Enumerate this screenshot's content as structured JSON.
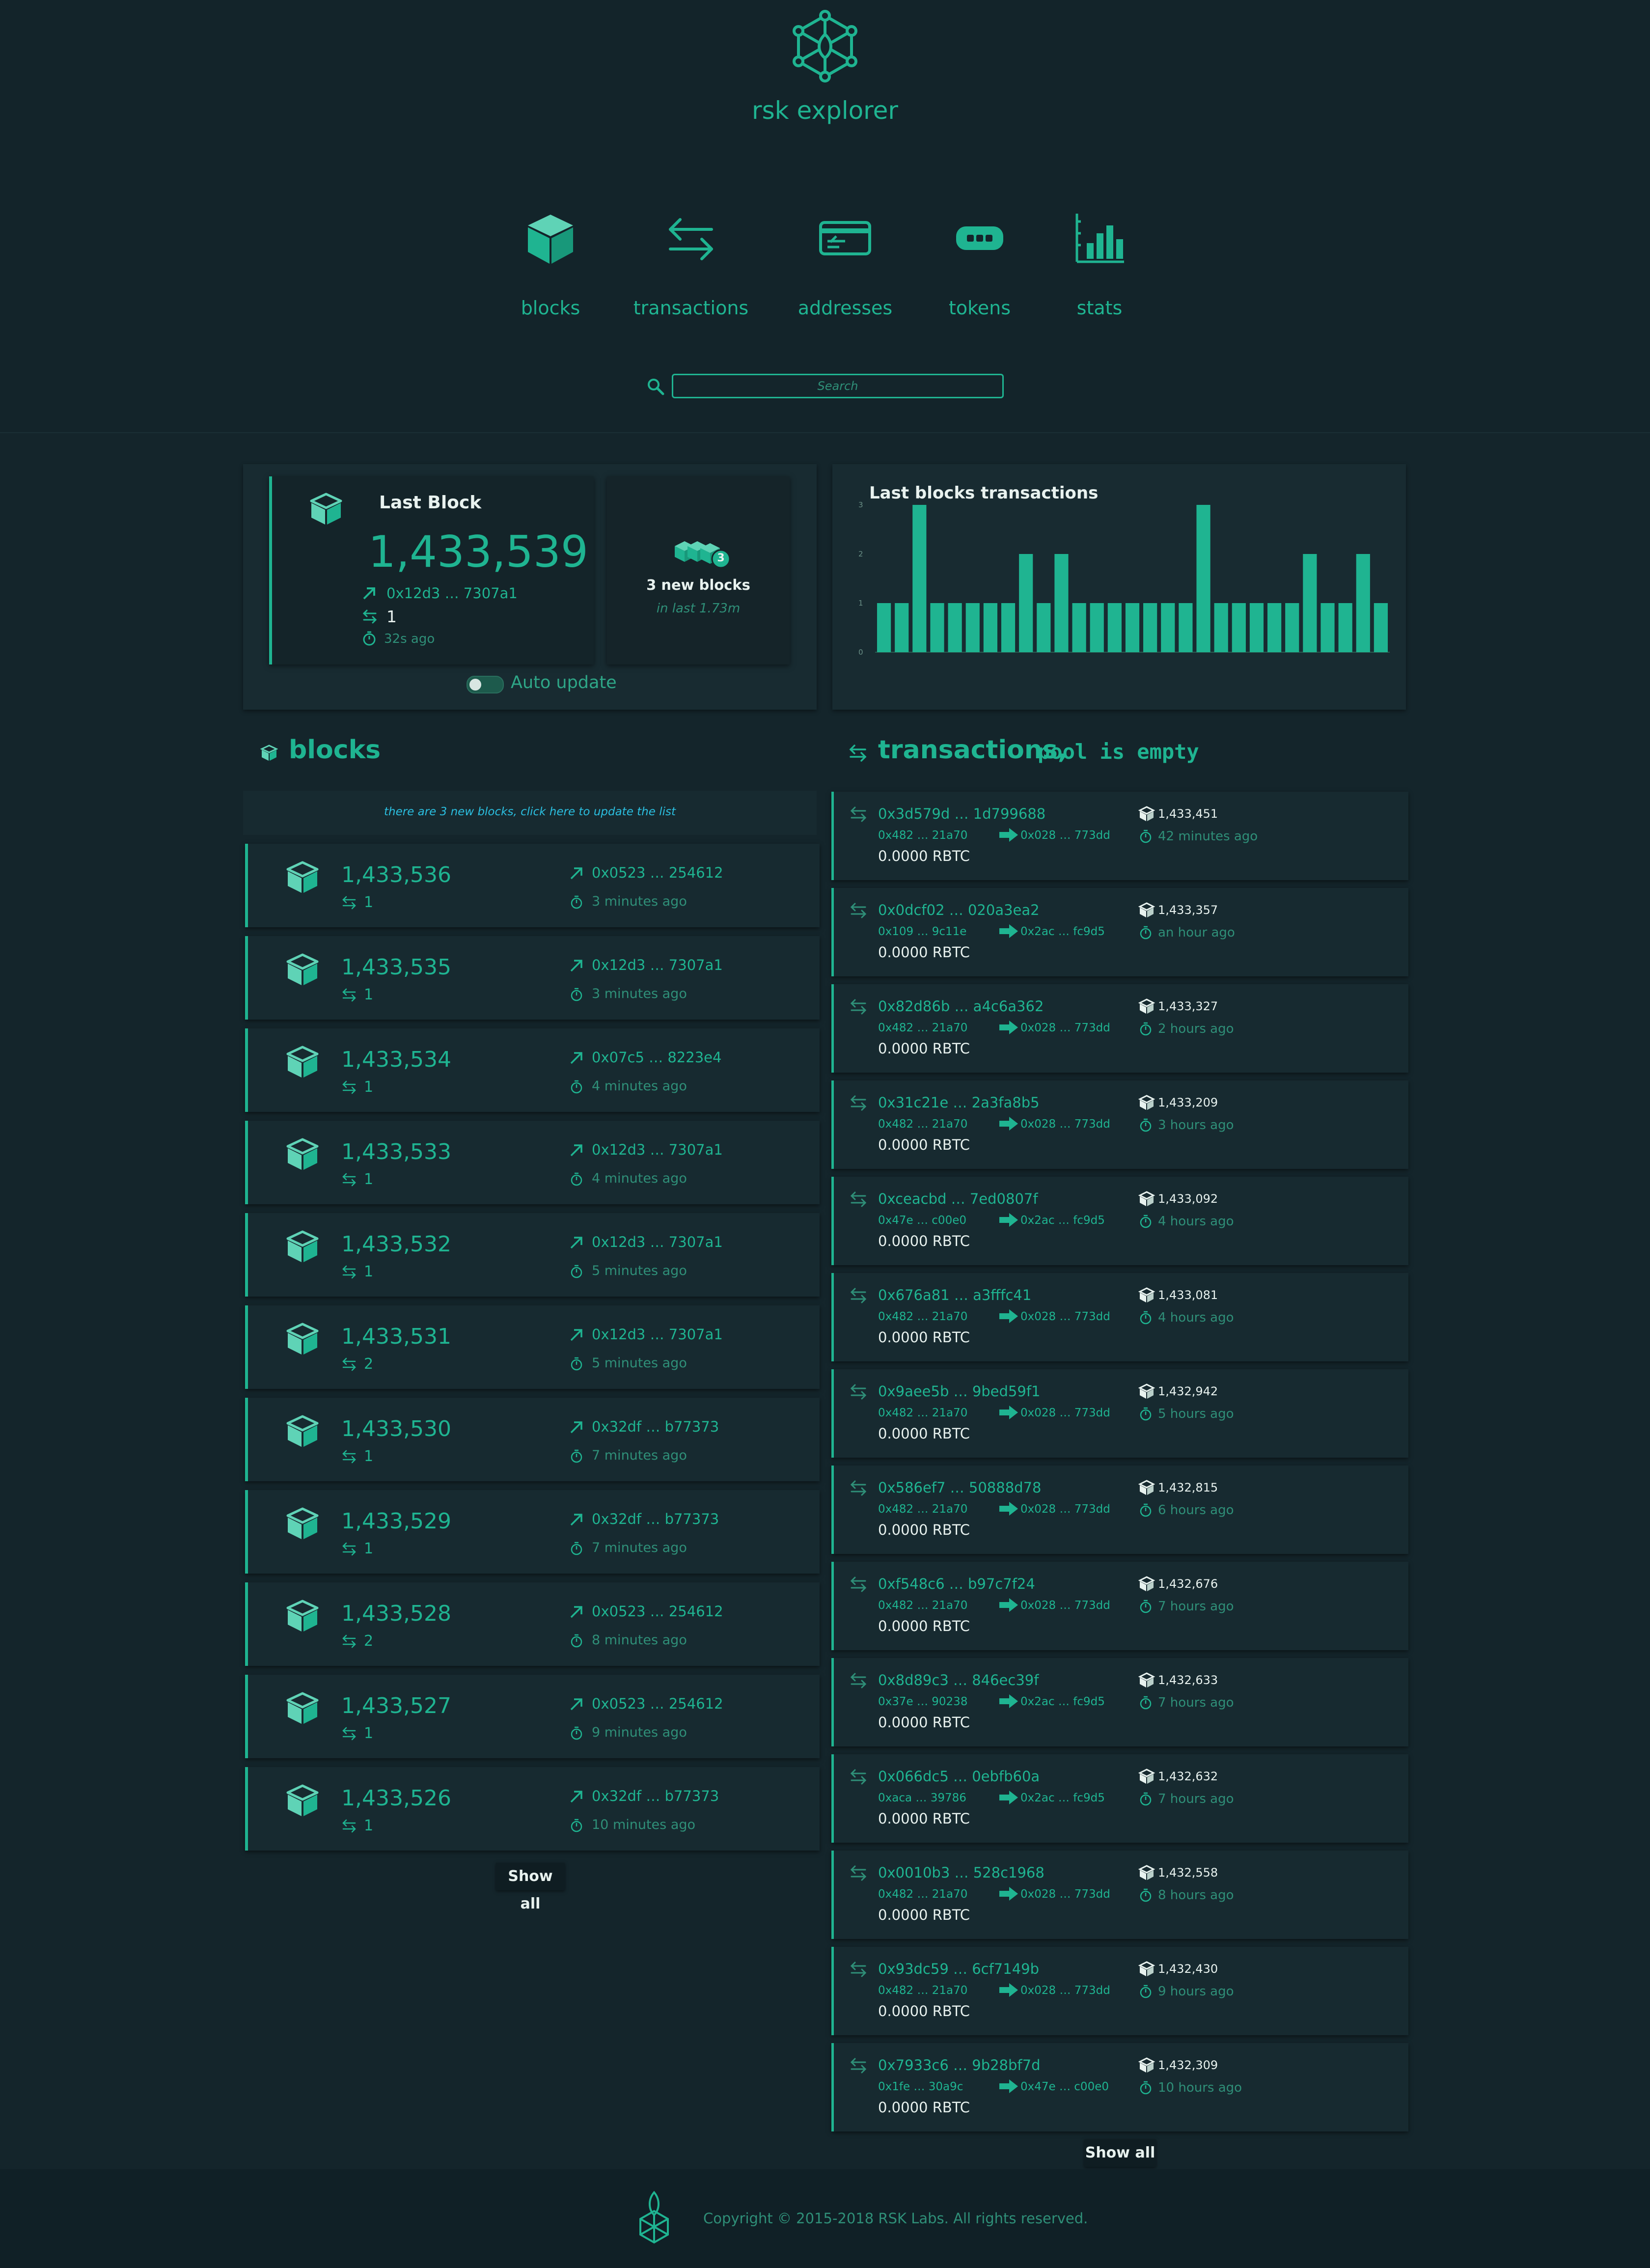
{
  "app": {
    "brand": "rsk explorer"
  },
  "nav": [
    {
      "label": "blocks",
      "icon": "cube-icon"
    },
    {
      "label": "transactions",
      "icon": "arrows-icon"
    },
    {
      "label": "addresses",
      "icon": "card-icon"
    },
    {
      "label": "tokens",
      "icon": "token-icon"
    },
    {
      "label": "stats",
      "icon": "bar-chart-icon"
    }
  ],
  "search": {
    "placeholder": "Search"
  },
  "last_block": {
    "title": "Last Block",
    "number": "1,433,539",
    "miner": "0x12d3 … 7307a1",
    "tx_count": "1",
    "age": "32s ago"
  },
  "new_blocks": {
    "badge": "3",
    "label": "3 new blocks",
    "period": "in last 1.73m"
  },
  "auto_update": {
    "label": "Auto update",
    "enabled": false
  },
  "chart_data": {
    "type": "bar",
    "title": "Last blocks transactions",
    "yticks": [
      "0",
      "1",
      "2",
      "3"
    ],
    "ylim": [
      0,
      3
    ],
    "values": [
      1,
      1,
      3,
      1,
      1,
      1,
      1,
      1,
      2,
      1,
      2,
      1,
      1,
      1,
      1,
      1,
      1,
      1,
      3,
      1,
      1,
      1,
      1,
      1,
      2,
      1,
      1,
      2,
      1
    ],
    "color": "#1fb491"
  },
  "blocks_section": {
    "title": "blocks",
    "banner": "there are 3 new blocks, click here to update the list",
    "show_all": "Show all",
    "rows": [
      {
        "number": "1,433,536",
        "txs": "1",
        "miner": "0x0523 … 254612",
        "time": "3 minutes ago"
      },
      {
        "number": "1,433,535",
        "txs": "1",
        "miner": "0x12d3 … 7307a1",
        "time": "3 minutes ago"
      },
      {
        "number": "1,433,534",
        "txs": "1",
        "miner": "0x07c5 … 8223e4",
        "time": "4 minutes ago"
      },
      {
        "number": "1,433,533",
        "txs": "1",
        "miner": "0x12d3 … 7307a1",
        "time": "4 minutes ago"
      },
      {
        "number": "1,433,532",
        "txs": "1",
        "miner": "0x12d3 … 7307a1",
        "time": "5 minutes ago"
      },
      {
        "number": "1,433,531",
        "txs": "2",
        "miner": "0x12d3 … 7307a1",
        "time": "5 minutes ago"
      },
      {
        "number": "1,433,530",
        "txs": "1",
        "miner": "0x32df … b77373",
        "time": "7 minutes ago"
      },
      {
        "number": "1,433,529",
        "txs": "1",
        "miner": "0x32df … b77373",
        "time": "7 minutes ago"
      },
      {
        "number": "1,433,528",
        "txs": "2",
        "miner": "0x0523 … 254612",
        "time": "8 minutes ago"
      },
      {
        "number": "1,433,527",
        "txs": "1",
        "miner": "0x0523 … 254612",
        "time": "9 minutes ago"
      },
      {
        "number": "1,433,526",
        "txs": "1",
        "miner": "0x32df … b77373",
        "time": "10 minutes ago"
      }
    ]
  },
  "transactions_section": {
    "title": "transactions,",
    "pool_status": "pool is empty",
    "show_all": "Show all",
    "rows": [
      {
        "hash": "0x3d579d … 1d799688",
        "from": "0x482 … 21a70",
        "to": "0x028 … 773dd",
        "value": "0.0000 RBTC",
        "block": "1,433,451",
        "time": "42 minutes ago"
      },
      {
        "hash": "0x0dcf02 … 020a3ea2",
        "from": "0x109 … 9c11e",
        "to": "0x2ac … fc9d5",
        "value": "0.0000 RBTC",
        "block": "1,433,357",
        "time": "an hour ago"
      },
      {
        "hash": "0x82d86b … a4c6a362",
        "from": "0x482 … 21a70",
        "to": "0x028 … 773dd",
        "value": "0.0000 RBTC",
        "block": "1,433,327",
        "time": "2 hours ago"
      },
      {
        "hash": "0x31c21e … 2a3fa8b5",
        "from": "0x482 … 21a70",
        "to": "0x028 … 773dd",
        "value": "0.0000 RBTC",
        "block": "1,433,209",
        "time": "3 hours ago"
      },
      {
        "hash": "0xceacbd … 7ed0807f",
        "from": "0x47e … c00e0",
        "to": "0x2ac … fc9d5",
        "value": "0.0000 RBTC",
        "block": "1,433,092",
        "time": "4 hours ago"
      },
      {
        "hash": "0x676a81 … a3fffc41",
        "from": "0x482 … 21a70",
        "to": "0x028 … 773dd",
        "value": "0.0000 RBTC",
        "block": "1,433,081",
        "time": "4 hours ago"
      },
      {
        "hash": "0x9aee5b … 9bed59f1",
        "from": "0x482 … 21a70",
        "to": "0x028 … 773dd",
        "value": "0.0000 RBTC",
        "block": "1,432,942",
        "time": "5 hours ago"
      },
      {
        "hash": "0x586ef7 … 50888d78",
        "from": "0x482 … 21a70",
        "to": "0x028 … 773dd",
        "value": "0.0000 RBTC",
        "block": "1,432,815",
        "time": "6 hours ago"
      },
      {
        "hash": "0xf548c6 … b97c7f24",
        "from": "0x482 … 21a70",
        "to": "0x028 … 773dd",
        "value": "0.0000 RBTC",
        "block": "1,432,676",
        "time": "7 hours ago"
      },
      {
        "hash": "0x8d89c3 … 846ec39f",
        "from": "0x37e … 90238",
        "to": "0x2ac … fc9d5",
        "value": "0.0000 RBTC",
        "block": "1,432,633",
        "time": "7 hours ago"
      },
      {
        "hash": "0x066dc5 … 0ebfb60a",
        "from": "0xaca … 39786",
        "to": "0x2ac … fc9d5",
        "value": "0.0000 RBTC",
        "block": "1,432,632",
        "time": "7 hours ago"
      },
      {
        "hash": "0x0010b3 … 528c1968",
        "from": "0x482 … 21a70",
        "to": "0x028 … 773dd",
        "value": "0.0000 RBTC",
        "block": "1,432,558",
        "time": "8 hours ago"
      },
      {
        "hash": "0x93dc59 … 6cf7149b",
        "from": "0x482 … 21a70",
        "to": "0x028 … 773dd",
        "value": "0.0000 RBTC",
        "block": "1,432,430",
        "time": "9 hours ago"
      },
      {
        "hash": "0x7933c6 … 9b28bf7d",
        "from": "0x1fe … 30a9c",
        "to": "0x47e … c00e0",
        "value": "0.0000 RBTC",
        "block": "1,432,309",
        "time": "10 hours ago"
      }
    ]
  },
  "footer": {
    "copyright": "Copyright © 2015-2018 RSK Labs. All rights reserved."
  }
}
